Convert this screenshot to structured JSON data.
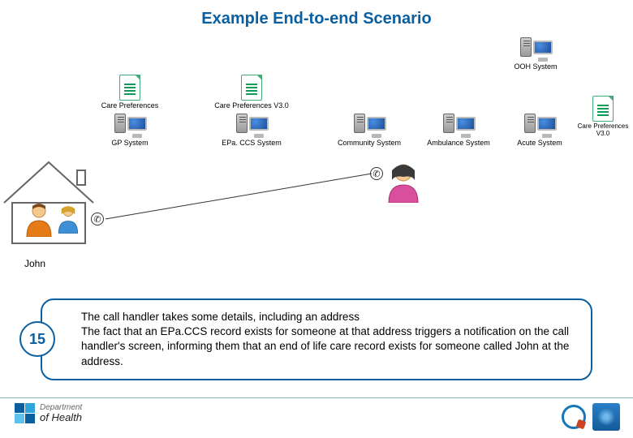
{
  "title": "Example End-to-end Scenario",
  "nodes": {
    "ooh": "OOH System",
    "care_pref_top_left": "Care Preferences",
    "care_pref_top_mid": "Care Preferences V3.0",
    "gp": "GP System",
    "epaccs": "EPa. CCS System",
    "community": "Community System",
    "ambulance": "Ambulance System",
    "acute": "Acute System",
    "care_pref_right": "Care Preferences V3.0"
  },
  "person_label": "John",
  "callout": {
    "num": "15",
    "text": "The call handler takes some details, including an address\nThe fact that an EPa.CCS record exists for someone at that address triggers a notification on the call handler's screen, informing them that an end of life care record exists for someone called John at the address."
  },
  "footer": {
    "dept_top": "Department",
    "dept_bottom": "of Health"
  }
}
